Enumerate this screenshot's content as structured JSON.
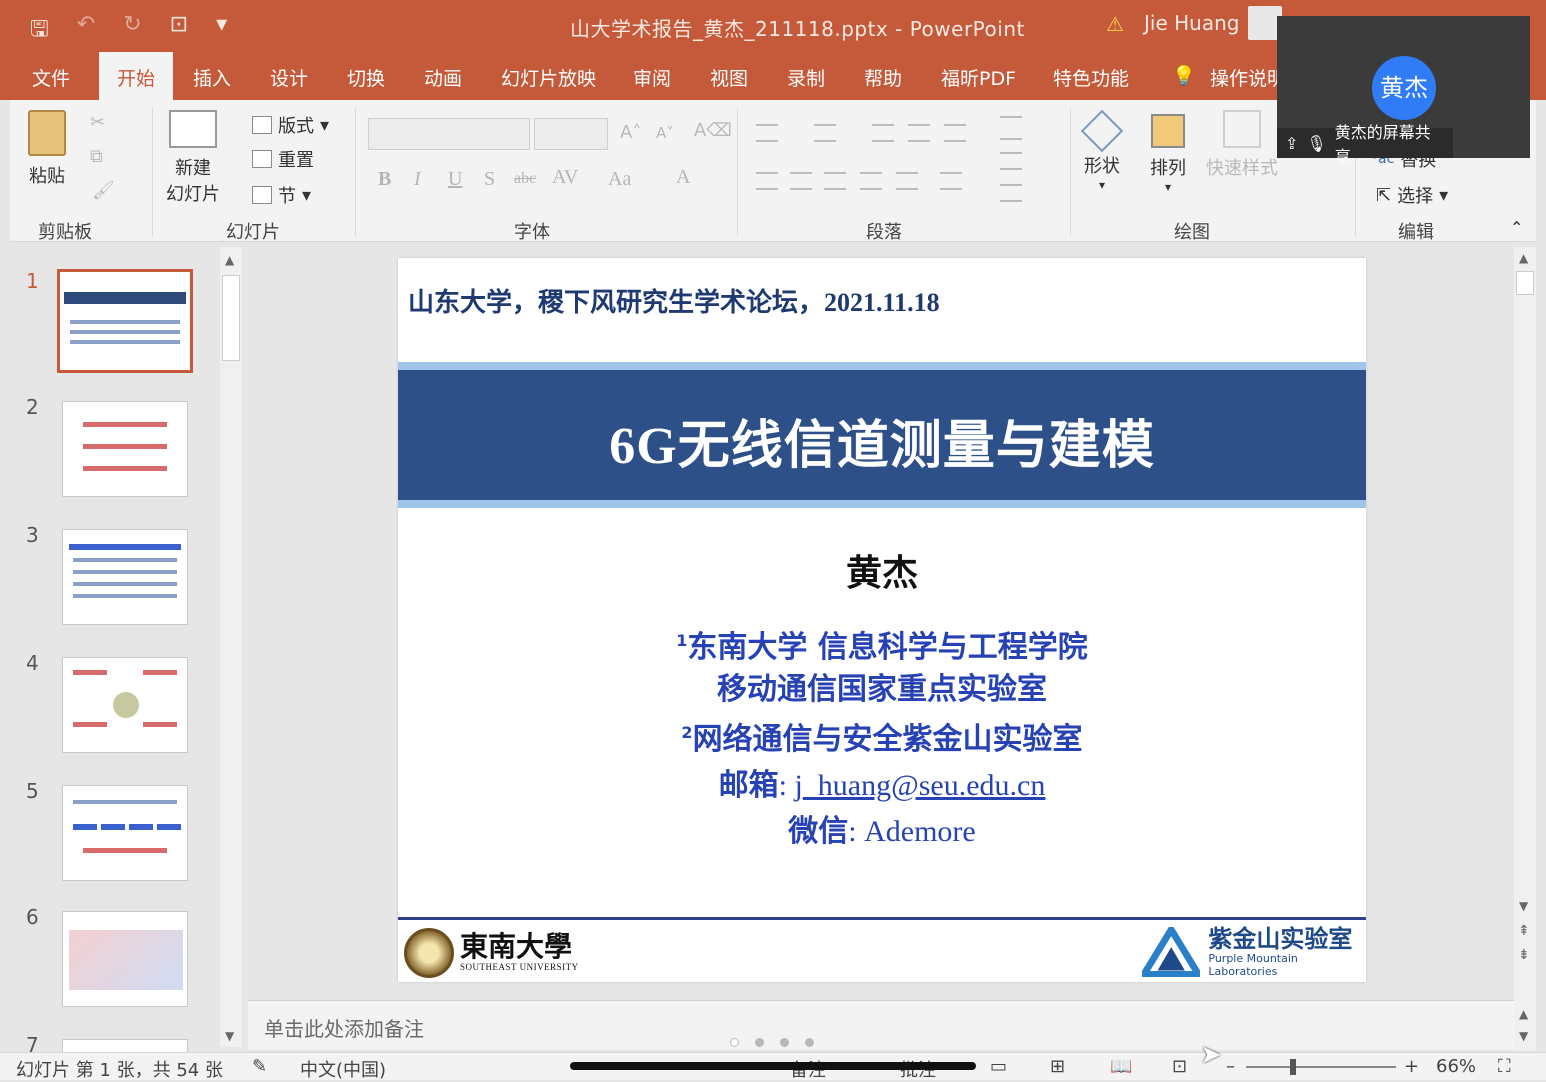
{
  "window": {
    "doc_title": "山大学术报告_黄杰_211118.pptx  -  PowerPoint",
    "user_name": "Jie Huang"
  },
  "colors": {
    "accent": "#c55a3a",
    "slide_banner": "#2e5088",
    "slide_text_blue": "#2742b5"
  },
  "tabs": [
    "文件",
    "开始",
    "插入",
    "设计",
    "切换",
    "动画",
    "幻灯片放映",
    "审阅",
    "视图",
    "录制",
    "帮助",
    "福昕PDF",
    "特色功能",
    "操作说明"
  ],
  "ribbon": {
    "paste": "粘贴",
    "new_slide_1": "新建",
    "new_slide_2": "幻灯片",
    "layout": "版式",
    "reset": "重置",
    "section": "节",
    "shapes": "形状",
    "arrange": "排列",
    "quick_styles": "快速样式",
    "replace": "替换",
    "select": "选择",
    "groups": {
      "clipboard": "剪贴板",
      "slides": "幻灯片",
      "font": "字体",
      "paragraph": "段落",
      "drawing": "绘图",
      "editing": "编辑"
    }
  },
  "video": {
    "avatar_text": "黄杰",
    "share_label": "黄杰的屏幕共享"
  },
  "thumbnails": [
    "1",
    "2",
    "3",
    "4",
    "5",
    "6",
    "7"
  ],
  "slide": {
    "forum": "山东大学，稷下风研究生学术论坛，2021.11.18",
    "title": "6G无线信道测量与建模",
    "author": "黄杰",
    "aff1_sup": "1",
    "aff1_line1": "东南大学 信息科学与工程学院",
    "aff1_line2": "移动通信国家重点实验室",
    "aff2_sup": "2",
    "aff2": "网络通信与安全紫金山实验室",
    "email_label": "邮箱",
    "email": "j_huang@seu.edu.cn",
    "wechat_label": "微信",
    "wechat": "Ademore",
    "logo_left_cn": "東南大學",
    "logo_left_en": "SOUTHEAST UNIVERSITY",
    "logo_right_cn": "紫金山实验室",
    "logo_right_en": "Purple Mountain Laboratories"
  },
  "notes_placeholder": "单击此处添加备注",
  "status": {
    "slide_info": "幻灯片 第 1 张，共 54 张",
    "language": "中文(中国)",
    "notes": "备注",
    "comments": "批注",
    "zoom": "66%"
  }
}
